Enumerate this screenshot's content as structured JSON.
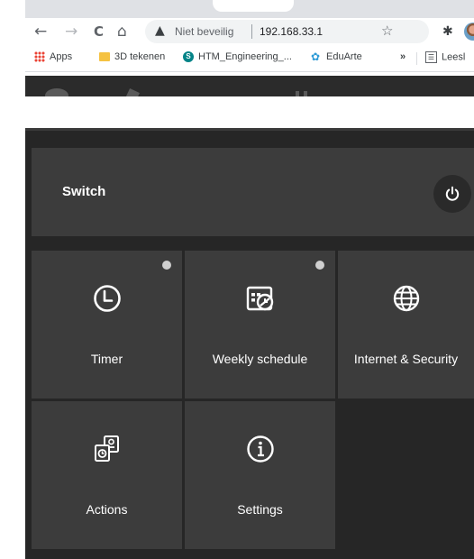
{
  "browser": {
    "nav": {
      "back": "←",
      "forward": "→",
      "reload": "C",
      "home": "⌂"
    },
    "address": {
      "warning_icon": "▲",
      "security_text": "Niet beveilig",
      "url": "192.168.33.1",
      "star": "☆"
    },
    "extensions_icon": "puzzle-icon",
    "bookmarks": [
      {
        "label": "Apps",
        "icon": "apps-grid-icon"
      },
      {
        "label": "3D tekenen",
        "icon": "folder-icon"
      },
      {
        "label": "HTM_Engineering_...",
        "icon": "sharepoint-icon"
      },
      {
        "label": "EduArte",
        "icon": "eduarte-icon"
      },
      {
        "label": "»",
        "icon": ""
      },
      {
        "label": "Leesl",
        "icon": "reading-list-icon"
      }
    ]
  },
  "app": {
    "switch_label": "Switch",
    "tiles": [
      {
        "label": "Timer",
        "icon": "clock-icon",
        "indicator": true
      },
      {
        "label": "Weekly schedule",
        "icon": "calendar-icon",
        "indicator": true
      },
      {
        "label": "Internet & Security",
        "icon": "globe-icon",
        "indicator": false
      },
      {
        "label": "Actions",
        "icon": "actions-icon",
        "indicator": false
      },
      {
        "label": "Settings",
        "icon": "info-icon",
        "indicator": false
      }
    ]
  },
  "colors": {
    "page_bg": "#262626",
    "card_bg": "#3c3c3c",
    "text": "#ffffff",
    "indicator": "#cfcfcf"
  }
}
